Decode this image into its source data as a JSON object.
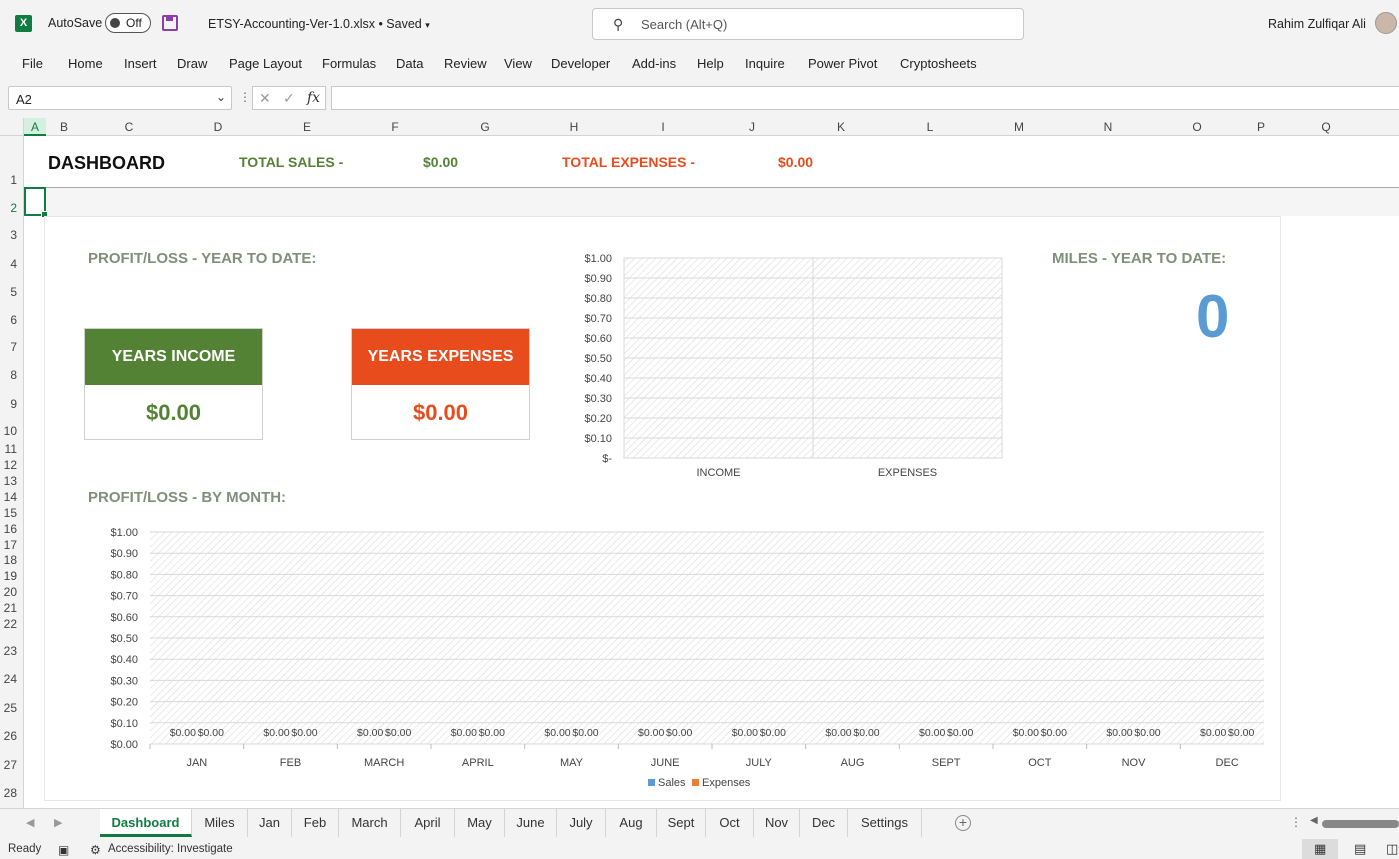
{
  "app": {
    "autosave_label": "AutoSave",
    "autosave_state": "Off",
    "filename": "ETSY-Accounting-Ver-1.0.xlsx • Saved",
    "username": "Rahim Zulfiqar Ali"
  },
  "search": {
    "placeholder": "Search (Alt+Q)"
  },
  "menu": [
    "File",
    "Home",
    "Insert",
    "Draw",
    "Page Layout",
    "Formulas",
    "Data",
    "Review",
    "View",
    "Developer",
    "Add-ins",
    "Help",
    "Inquire",
    "Power Pivot",
    "Cryptosheets"
  ],
  "formula": {
    "namebox": "A2",
    "value": ""
  },
  "columns": [
    "A",
    "B",
    "C",
    "D",
    "E",
    "F",
    "G",
    "H",
    "I",
    "J",
    "K",
    "L",
    "M",
    "N",
    "O",
    "P",
    "Q"
  ],
  "rows": [
    "1",
    "2",
    "3",
    "4",
    "5",
    "6",
    "7",
    "8",
    "9",
    "10",
    "11",
    "12",
    "13",
    "14",
    "15",
    "16",
    "17",
    "18",
    "19",
    "20",
    "21",
    "22",
    "23",
    "24",
    "25",
    "26",
    "27",
    "28"
  ],
  "dashboard": {
    "title": "DASHBOARD",
    "total_sales_label": "TOTAL SALES -",
    "total_sales_value": "$0.00",
    "total_expenses_label": "TOTAL EXPENSES -",
    "total_expenses_value": "$0.00",
    "ytd_title": "PROFIT/LOSS - YEAR TO DATE:",
    "income_card": {
      "label": "YEARS INCOME",
      "value": "$0.00"
    },
    "expenses_card": {
      "label": "YEARS EXPENSES",
      "value": "$0.00"
    },
    "miles_title": "MILES - YEAR TO DATE:",
    "miles_value": "0",
    "month_title": "PROFIT/LOSS - BY MONTH:"
  },
  "colors": {
    "green": "#548235",
    "red": "#e84c1c",
    "sales": "#5b9bd5",
    "expenses": "#ed7d31"
  },
  "chart_data": [
    {
      "type": "bar",
      "categories": [
        "INCOME",
        "EXPENSES"
      ],
      "values": [
        0,
        0
      ],
      "ylim": [
        0,
        1
      ],
      "y_ticks": [
        "$-",
        "$0.10",
        "$0.20",
        "$0.30",
        "$0.40",
        "$0.50",
        "$0.60",
        "$0.70",
        "$0.80",
        "$0.90",
        "$1.00"
      ]
    },
    {
      "type": "bar",
      "categories": [
        "JAN",
        "FEB",
        "MARCH",
        "APRIL",
        "MAY",
        "JUNE",
        "JULY",
        "AUG",
        "SEPT",
        "OCT",
        "NOV",
        "DEC"
      ],
      "series": [
        {
          "name": "Sales",
          "values": [
            0,
            0,
            0,
            0,
            0,
            0,
            0,
            0,
            0,
            0,
            0,
            0
          ]
        },
        {
          "name": "Expenses",
          "values": [
            0,
            0,
            0,
            0,
            0,
            0,
            0,
            0,
            0,
            0,
            0,
            0
          ]
        }
      ],
      "data_label": "$0.00",
      "legend": "bottom",
      "ylim": [
        0,
        1
      ],
      "y_ticks": [
        "$0.00",
        "$0.10",
        "$0.20",
        "$0.30",
        "$0.40",
        "$0.50",
        "$0.60",
        "$0.70",
        "$0.80",
        "$0.90",
        "$1.00"
      ]
    }
  ],
  "tabs": [
    "Dashboard",
    "Miles",
    "Jan",
    "Feb",
    "March",
    "April",
    "May",
    "June",
    "July",
    "Aug",
    "Sept",
    "Oct",
    "Nov",
    "Dec",
    "Settings"
  ],
  "active_tab": "Dashboard",
  "status": {
    "ready": "Ready",
    "accessibility": "Accessibility: Investigate"
  }
}
